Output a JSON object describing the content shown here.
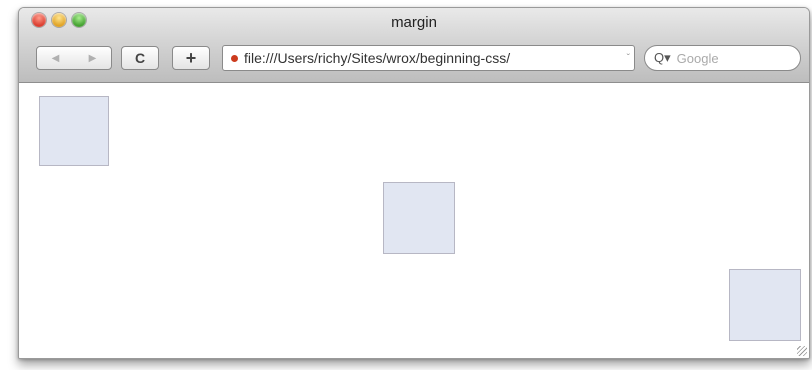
{
  "window": {
    "title": "margin"
  },
  "toolbar": {
    "back_icon": "back-arrow-icon",
    "forward_icon": "forward-arrow-icon",
    "reload_label": "C",
    "add_label": "+",
    "url": "file:///Users/richy/Sites/wrox/beginning-css/",
    "url_suffix": "ˇ",
    "search_placeholder": "Google",
    "search_icon": "Q▾"
  },
  "content": {
    "boxes": [
      {
        "name": "top-left"
      },
      {
        "name": "center"
      },
      {
        "name": "bottom-right"
      }
    ],
    "colors": {
      "box_fill": "#e1e6f2",
      "box_border": "#b7b7c4"
    }
  }
}
